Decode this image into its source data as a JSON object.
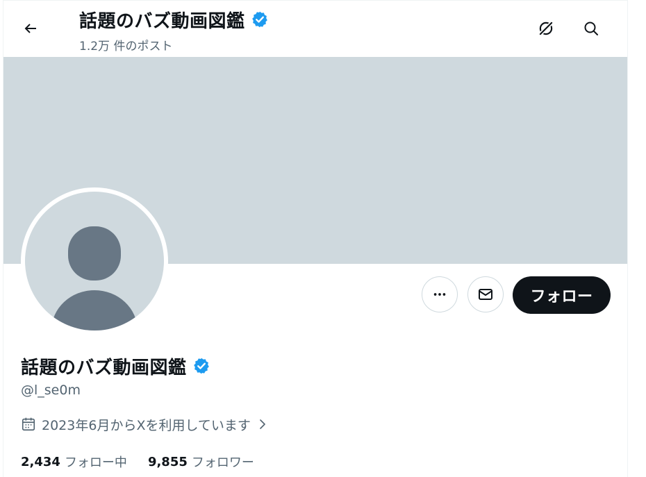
{
  "header": {
    "title": "話題のバズ動画図鑑",
    "post_count": "1.2万 件のポスト",
    "back_icon": "arrow-left-icon",
    "icons": [
      "unlink-icon",
      "search-icon"
    ]
  },
  "profile": {
    "name": "話題のバズ動画図鑑",
    "handle": "@l_se0m",
    "verified": true,
    "joined": "2023年6月からXを利用しています",
    "following_count": "2,434",
    "following_label": "フォロー中",
    "followers_count": "9,855",
    "followers_label": "フォロワー"
  },
  "actions": {
    "more_icon": "more-dots-icon",
    "message_icon": "envelope-icon",
    "follow_label": "フォロー"
  },
  "colors": {
    "banner": "#cfd9de",
    "avatar_bg": "#cfd9de",
    "avatar_figure": "#687785",
    "verified": "#1d9bf0",
    "text_primary": "#0f1419",
    "text_secondary": "#536471",
    "follow_bg": "#0f1419"
  }
}
